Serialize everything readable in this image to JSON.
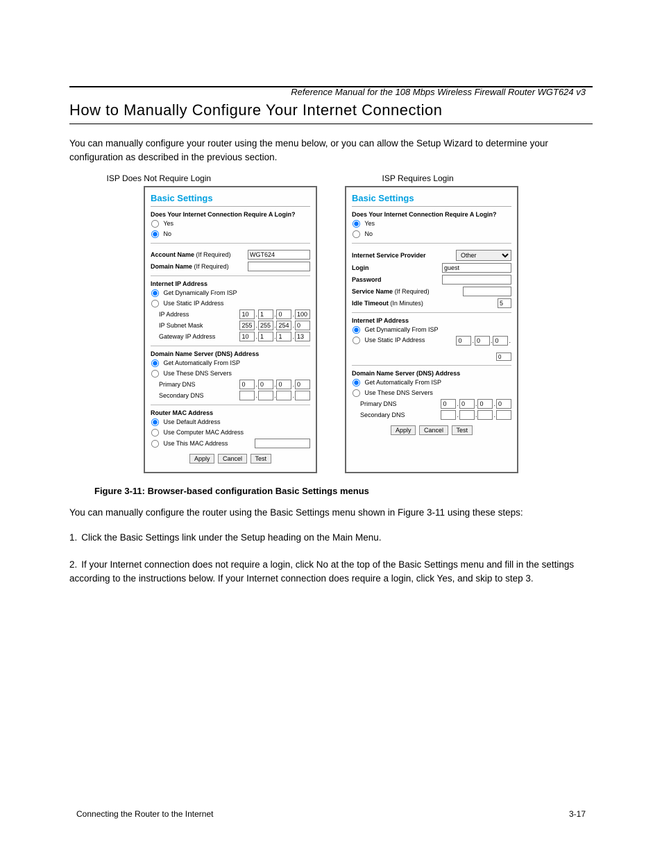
{
  "doc_header_right": "Reference Manual for the 108 Mbps Wireless Firewall Router WGT624 v3",
  "section_title": "How to Manually Configure Your Internet Connection",
  "intro_text": "You can manually configure your router using the menu below, or you can allow the Setup Wizard to determine your configuration as described in the previous section.",
  "isp_no_login": "ISP Does Not Require Login",
  "isp_requires_login": "ISP Requires Login",
  "steps": {
    "header_1": "You can manually configure the router using the Basic Settings menu shown in Figure 3-11 using these steps:",
    "step1": "Click the Basic Settings link under the Setup heading on the Main Menu.",
    "step2": "If your Internet connection does not require a login, click No at the top of the Basic Settings menu and fill in the settings according to the instructions below. If your Internet connection does require a login, click Yes, and skip to step 3."
  },
  "panel_common": {
    "title": "Basic Settings",
    "q_login": "Does Your Internet Connection Require A Login?",
    "yes": "Yes",
    "no": "No",
    "internet_ip_address": "Internet IP Address",
    "get_dyn": "Get Dynamically From ISP",
    "use_static": "Use Static IP Address",
    "dns_title": "Domain Name Server (DNS) Address",
    "get_auto_dns": "Get Automatically From ISP",
    "use_dns": "Use These DNS Servers",
    "primary_dns": "Primary DNS",
    "secondary_dns": "Secondary DNS",
    "apply": "Apply",
    "cancel": "Cancel",
    "test": "Test"
  },
  "panel_left": {
    "account_name_label": "Account Name",
    "if_required": "(If Required)",
    "domain_name_label": "Domain Name",
    "account_name_value": "WGT624",
    "ip_address": "IP Address",
    "ip_subnet": "IP Subnet Mask",
    "gateway": "Gateway IP Address",
    "ip_vals": {
      "a": "10",
      "b": "1",
      "c": "0",
      "d": "100"
    },
    "mask_vals": {
      "a": "255",
      "b": "255",
      "c": "254",
      "d": "0"
    },
    "gw_vals": {
      "a": "10",
      "b": "1",
      "c": "1",
      "d": "13"
    },
    "dns_vals": {
      "a": "0",
      "b": "0",
      "c": "0",
      "d": "0"
    },
    "router_mac_title": "Router MAC Address",
    "use_default_addr": "Use Default Address",
    "use_computer_mac": "Use Computer MAC Address",
    "use_this_mac": "Use This MAC Address"
  },
  "panel_right": {
    "isp_label": "Internet Service Provider",
    "isp_select": "Other",
    "login_label": "Login",
    "login_value": "guest",
    "password_label": "Password",
    "service_name_label": "Service Name",
    "if_required": "(If Required)",
    "idle_timeout_label": "Idle Timeout",
    "idle_timeout_unit": "(In Minutes)",
    "idle_timeout_value": "5",
    "static_ip_vals": {
      "a": "0",
      "b": "0",
      "c": "0",
      "d": "0"
    },
    "dns_vals": {
      "a": "0",
      "b": "0",
      "c": "0",
      "d": "0"
    }
  },
  "figure_caption": "Figure 3-11:  Browser-based configuration Basic Settings menus",
  "footer_left": "Connecting the Router to the Internet",
  "footer_right": "3-17"
}
